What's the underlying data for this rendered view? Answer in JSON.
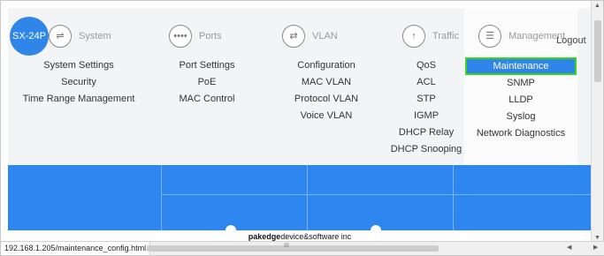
{
  "device": {
    "model": "SX-24P"
  },
  "header": {
    "logout_label": "Logout"
  },
  "menu": {
    "system": {
      "label": "System",
      "icon": "sliders-icon",
      "items": [
        "System Settings",
        "Security",
        "Time Range Management"
      ]
    },
    "ports": {
      "label": "Ports",
      "icon": "dots-icon",
      "items": [
        "Port Settings",
        "PoE",
        "MAC Control"
      ]
    },
    "vlan": {
      "label": "VLAN",
      "icon": "network-icon",
      "items": [
        "Configuration",
        "MAC VLAN",
        "Protocol VLAN",
        "Voice VLAN"
      ]
    },
    "traffic": {
      "label": "Traffic",
      "icon": "arrow-up-icon",
      "items": [
        "QoS",
        "ACL",
        "STP",
        "IGMP",
        "DHCP Relay",
        "DHCP Snooping"
      ]
    },
    "management": {
      "label": "Management",
      "icon": "list-icon",
      "items": [
        "Maintenance",
        "SNMP",
        "LLDP",
        "Syslog",
        "Network Diagnostics"
      ],
      "active_index": 0
    }
  },
  "footer": {
    "brand_bold": "pakedge",
    "brand_rest": "device&software inc"
  },
  "status": {
    "url": "192.168.1.205/maintenance_config.html",
    "grip": "III"
  },
  "colors": {
    "accent": "#2f86e8",
    "highlight_border": "#39d61c",
    "blue_area": "#2e86f0"
  }
}
